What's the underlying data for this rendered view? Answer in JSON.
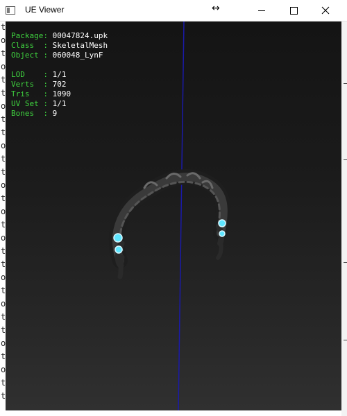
{
  "window": {
    "title": "UE Viewer",
    "app_icon": "window-app-icon",
    "resize_cursor": "↔",
    "buttons": {
      "minimize": "minimize-icon",
      "maximize": "maximize-icon",
      "close": "close-icon"
    }
  },
  "background_text": [
    "t",
    "o",
    "t",
    "o",
    "t",
    "t",
    "o",
    "t",
    "t",
    "o",
    "t",
    "t",
    "o",
    "t",
    "o",
    "t",
    "o",
    "t",
    "t",
    "o",
    "t",
    "o",
    "t",
    "t",
    "o",
    "t",
    "o",
    "t",
    "t"
  ],
  "info": {
    "package": {
      "label": "Package: ",
      "value": "00047824.upk"
    },
    "class": {
      "label": "Class  : ",
      "value": "SkeletalMesh"
    },
    "object": {
      "label": "Object : ",
      "value": "060048_LynF"
    },
    "lod": {
      "label": "LOD    : ",
      "value": "1/1"
    },
    "verts": {
      "label": "Verts  : ",
      "value": "702"
    },
    "tris": {
      "label": "Tris   : ",
      "value": "1090"
    },
    "uvset": {
      "label": "UV Set : ",
      "value": "1/1"
    },
    "bones": {
      "label": "Bones  : ",
      "value": "9"
    }
  },
  "colors": {
    "label_green": "#3fd23f",
    "value_white": "#ffffff",
    "axis_blue": "#1a1aa8",
    "gem_cyan": "#5fe6ff",
    "mesh_dark": "#2b2b2b"
  }
}
